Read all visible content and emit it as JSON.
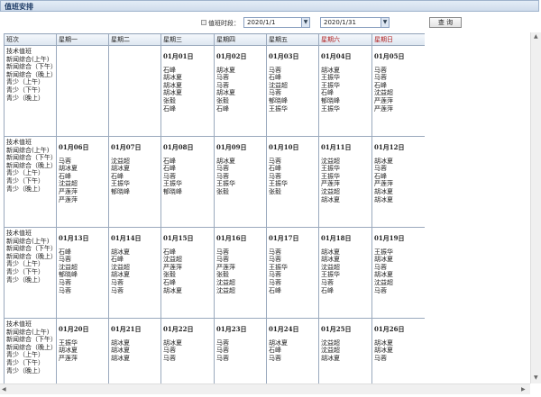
{
  "window_title": "值班安排",
  "toolbar": {
    "period_label": "值班时段：",
    "start_date": "2020/1/1",
    "end_date": "2020/1/31",
    "query_label": "查 询"
  },
  "columns": [
    "班次",
    "星期一",
    "星期二",
    "星期三",
    "星期四",
    "星期五",
    "星期六",
    "星期日"
  ],
  "shift_labels": [
    "技术值班",
    "新闻综合(上午)",
    "新闻综合（下午）",
    "新闻综合（晚上）",
    "青少（上午）",
    "青少（下午）",
    "青少（晚上）"
  ],
  "weeks": [
    [
      null,
      null,
      {
        "day": "01月01日",
        "names": [
          "石峰",
          "胡冰夏",
          "胡冰夏",
          "胡冰夏",
          "张毅",
          "石峰"
        ]
      },
      {
        "day": "01月02日",
        "names": [
          "胡冰夏",
          "马蓉",
          "马蓉",
          "胡冰夏",
          "张毅",
          "石峰"
        ]
      },
      {
        "day": "01月03日",
        "names": [
          "马蓉",
          "石峰",
          "沈益超",
          "马蓉",
          "郁晓峰",
          "王振华"
        ]
      },
      {
        "day": "01月04日",
        "names": [
          "胡冰夏",
          "王振华",
          "王振华",
          "石峰",
          "郁晓峰",
          "王振华"
        ]
      },
      {
        "day": "01月05日",
        "names": [
          "马蓉",
          "马蓉",
          "石峰",
          "沈益超",
          "严莲萍",
          "严莲萍"
        ]
      }
    ],
    [
      {
        "day": "01月06日",
        "names": [
          "马蓉",
          "胡冰夏",
          "石峰",
          "沈益超",
          "严莲萍",
          "严莲萍"
        ]
      },
      {
        "day": "01月07日",
        "names": [
          "沈益超",
          "胡冰夏",
          "石峰",
          "王振华",
          "郁晓峰"
        ]
      },
      {
        "day": "01月08日",
        "names": [
          "石峰",
          "石峰",
          "马蓉",
          "王振华",
          "郁晓峰"
        ]
      },
      {
        "day": "01月09日",
        "names": [
          "胡冰夏",
          "马蓉",
          "马蓉",
          "王振华",
          "张毅"
        ]
      },
      {
        "day": "01月10日",
        "names": [
          "马蓉",
          "石峰",
          "马蓉",
          "王振华",
          "张毅"
        ]
      },
      {
        "day": "01月11日",
        "names": [
          "沈益超",
          "王振华",
          "王振华",
          "严莲萍",
          "沈益超",
          "胡冰夏"
        ]
      },
      {
        "day": "01月12日",
        "names": [
          "胡冰夏",
          "马蓉",
          "石峰",
          "严莲萍",
          "胡冰夏",
          "胡冰夏"
        ]
      }
    ],
    [
      {
        "day": "01月13日",
        "names": [
          "石峰",
          "马蓉",
          "沈益超",
          "郁晓峰",
          "马蓉",
          "马蓉"
        ]
      },
      {
        "day": "01月14日",
        "names": [
          "胡冰夏",
          "石峰",
          "沈益超",
          "胡冰夏",
          "马蓉",
          "马蓉"
        ]
      },
      {
        "day": "01月15日",
        "names": [
          "石峰",
          "沈益超",
          "严莲萍",
          "张毅",
          "石峰",
          "胡冰夏"
        ]
      },
      {
        "day": "01月16日",
        "names": [
          "马蓉",
          "马蓉",
          "严莲萍",
          "张毅",
          "沈益超",
          "沈益超"
        ]
      },
      {
        "day": "01月17日",
        "names": [
          "马蓉",
          "马蓉",
          "王振华",
          "马蓉",
          "马蓉",
          "石峰"
        ]
      },
      {
        "day": "01月18日",
        "names": [
          "胡冰夏",
          "胡冰夏",
          "沈益超",
          "王振华",
          "马蓉",
          "石峰"
        ]
      },
      {
        "day": "01月19日",
        "names": [
          "王振华",
          "胡冰夏",
          "马蓉",
          "胡冰夏",
          "沈益超",
          "马蓉"
        ]
      }
    ],
    [
      {
        "day": "01月20日",
        "names": [
          "王振华",
          "胡冰夏",
          "严莲萍"
        ]
      },
      {
        "day": "01月21日",
        "names": [
          "胡冰夏",
          "胡冰夏",
          "胡冰夏"
        ]
      },
      {
        "day": "01月22日",
        "names": [
          "胡冰夏",
          "马蓉",
          "马蓉"
        ]
      },
      {
        "day": "01月23日",
        "names": [
          "马蓉",
          "马蓉",
          "马蓉"
        ]
      },
      {
        "day": "01月24日",
        "names": [
          "胡冰夏",
          "石峰",
          "马蓉"
        ]
      },
      {
        "day": "01月25日",
        "names": [
          "沈益超",
          "沈益超",
          "胡冰夏"
        ]
      },
      {
        "day": "01月26日",
        "names": [
          "胡冰夏",
          "胡冰夏",
          "马蓉"
        ]
      }
    ]
  ]
}
